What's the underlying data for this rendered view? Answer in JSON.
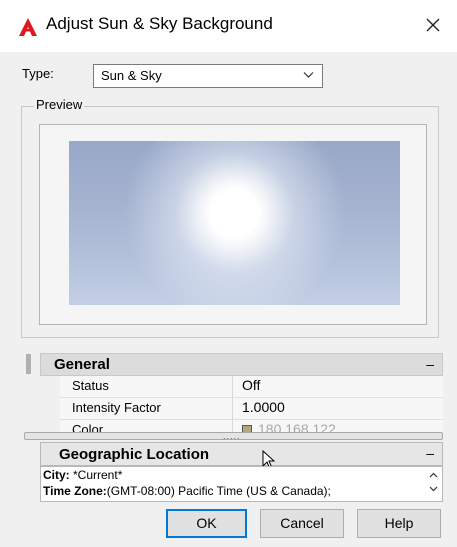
{
  "window": {
    "title": "Adjust Sun & Sky Background"
  },
  "type_row": {
    "label": "Type:",
    "selected": "Sun & Sky"
  },
  "preview": {
    "label": "Preview"
  },
  "general": {
    "title": "General",
    "collapse": "–",
    "rows": [
      {
        "key": "Status",
        "value": "Off"
      },
      {
        "key": "Intensity Factor",
        "value": "1.0000"
      },
      {
        "key": "Color",
        "value": "180,168,122"
      }
    ]
  },
  "splitter": {
    "grip": "....."
  },
  "geo": {
    "title": "Geographic Location",
    "collapse": "–",
    "city_label": "City:",
    "city_value": " *Current*",
    "tz_label": "Time Zone:",
    "tz_value": "(GMT-08:00) Pacific Time (US & Canada);"
  },
  "buttons": {
    "ok": "OK",
    "cancel": "Cancel",
    "help": "Help"
  },
  "colors": {
    "accent": "#0078d7",
    "logo": "#e0171e"
  },
  "icons": {
    "logo": "autocad-logo-icon",
    "close": "close-icon",
    "dropdown": "chevron-down-icon",
    "cursor": "mouse-pointer-icon"
  }
}
